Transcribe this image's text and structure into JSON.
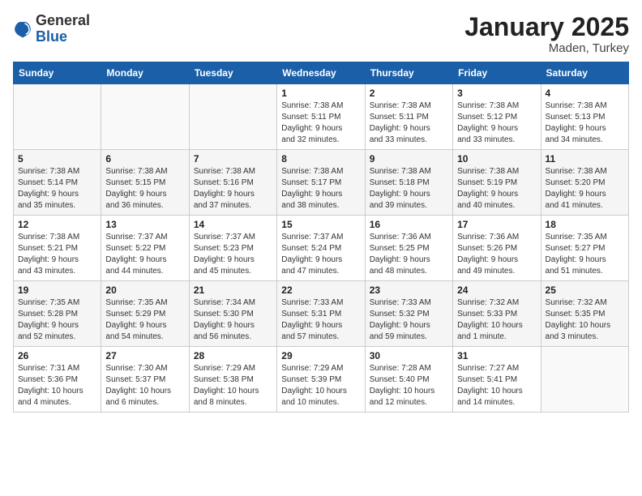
{
  "header": {
    "logo_general": "General",
    "logo_blue": "Blue",
    "title": "January 2025",
    "subtitle": "Maden, Turkey"
  },
  "weekdays": [
    "Sunday",
    "Monday",
    "Tuesday",
    "Wednesday",
    "Thursday",
    "Friday",
    "Saturday"
  ],
  "weeks": [
    [
      {
        "day": "",
        "info": ""
      },
      {
        "day": "",
        "info": ""
      },
      {
        "day": "",
        "info": ""
      },
      {
        "day": "1",
        "info": "Sunrise: 7:38 AM\nSunset: 5:11 PM\nDaylight: 9 hours\nand 32 minutes."
      },
      {
        "day": "2",
        "info": "Sunrise: 7:38 AM\nSunset: 5:11 PM\nDaylight: 9 hours\nand 33 minutes."
      },
      {
        "day": "3",
        "info": "Sunrise: 7:38 AM\nSunset: 5:12 PM\nDaylight: 9 hours\nand 33 minutes."
      },
      {
        "day": "4",
        "info": "Sunrise: 7:38 AM\nSunset: 5:13 PM\nDaylight: 9 hours\nand 34 minutes."
      }
    ],
    [
      {
        "day": "5",
        "info": "Sunrise: 7:38 AM\nSunset: 5:14 PM\nDaylight: 9 hours\nand 35 minutes."
      },
      {
        "day": "6",
        "info": "Sunrise: 7:38 AM\nSunset: 5:15 PM\nDaylight: 9 hours\nand 36 minutes."
      },
      {
        "day": "7",
        "info": "Sunrise: 7:38 AM\nSunset: 5:16 PM\nDaylight: 9 hours\nand 37 minutes."
      },
      {
        "day": "8",
        "info": "Sunrise: 7:38 AM\nSunset: 5:17 PM\nDaylight: 9 hours\nand 38 minutes."
      },
      {
        "day": "9",
        "info": "Sunrise: 7:38 AM\nSunset: 5:18 PM\nDaylight: 9 hours\nand 39 minutes."
      },
      {
        "day": "10",
        "info": "Sunrise: 7:38 AM\nSunset: 5:19 PM\nDaylight: 9 hours\nand 40 minutes."
      },
      {
        "day": "11",
        "info": "Sunrise: 7:38 AM\nSunset: 5:20 PM\nDaylight: 9 hours\nand 41 minutes."
      }
    ],
    [
      {
        "day": "12",
        "info": "Sunrise: 7:38 AM\nSunset: 5:21 PM\nDaylight: 9 hours\nand 43 minutes."
      },
      {
        "day": "13",
        "info": "Sunrise: 7:37 AM\nSunset: 5:22 PM\nDaylight: 9 hours\nand 44 minutes."
      },
      {
        "day": "14",
        "info": "Sunrise: 7:37 AM\nSunset: 5:23 PM\nDaylight: 9 hours\nand 45 minutes."
      },
      {
        "day": "15",
        "info": "Sunrise: 7:37 AM\nSunset: 5:24 PM\nDaylight: 9 hours\nand 47 minutes."
      },
      {
        "day": "16",
        "info": "Sunrise: 7:36 AM\nSunset: 5:25 PM\nDaylight: 9 hours\nand 48 minutes."
      },
      {
        "day": "17",
        "info": "Sunrise: 7:36 AM\nSunset: 5:26 PM\nDaylight: 9 hours\nand 49 minutes."
      },
      {
        "day": "18",
        "info": "Sunrise: 7:35 AM\nSunset: 5:27 PM\nDaylight: 9 hours\nand 51 minutes."
      }
    ],
    [
      {
        "day": "19",
        "info": "Sunrise: 7:35 AM\nSunset: 5:28 PM\nDaylight: 9 hours\nand 52 minutes."
      },
      {
        "day": "20",
        "info": "Sunrise: 7:35 AM\nSunset: 5:29 PM\nDaylight: 9 hours\nand 54 minutes."
      },
      {
        "day": "21",
        "info": "Sunrise: 7:34 AM\nSunset: 5:30 PM\nDaylight: 9 hours\nand 56 minutes."
      },
      {
        "day": "22",
        "info": "Sunrise: 7:33 AM\nSunset: 5:31 PM\nDaylight: 9 hours\nand 57 minutes."
      },
      {
        "day": "23",
        "info": "Sunrise: 7:33 AM\nSunset: 5:32 PM\nDaylight: 9 hours\nand 59 minutes."
      },
      {
        "day": "24",
        "info": "Sunrise: 7:32 AM\nSunset: 5:33 PM\nDaylight: 10 hours\nand 1 minute."
      },
      {
        "day": "25",
        "info": "Sunrise: 7:32 AM\nSunset: 5:35 PM\nDaylight: 10 hours\nand 3 minutes."
      }
    ],
    [
      {
        "day": "26",
        "info": "Sunrise: 7:31 AM\nSunset: 5:36 PM\nDaylight: 10 hours\nand 4 minutes."
      },
      {
        "day": "27",
        "info": "Sunrise: 7:30 AM\nSunset: 5:37 PM\nDaylight: 10 hours\nand 6 minutes."
      },
      {
        "day": "28",
        "info": "Sunrise: 7:29 AM\nSunset: 5:38 PM\nDaylight: 10 hours\nand 8 minutes."
      },
      {
        "day": "29",
        "info": "Sunrise: 7:29 AM\nSunset: 5:39 PM\nDaylight: 10 hours\nand 10 minutes."
      },
      {
        "day": "30",
        "info": "Sunrise: 7:28 AM\nSunset: 5:40 PM\nDaylight: 10 hours\nand 12 minutes."
      },
      {
        "day": "31",
        "info": "Sunrise: 7:27 AM\nSunset: 5:41 PM\nDaylight: 10 hours\nand 14 minutes."
      },
      {
        "day": "",
        "info": ""
      }
    ]
  ]
}
